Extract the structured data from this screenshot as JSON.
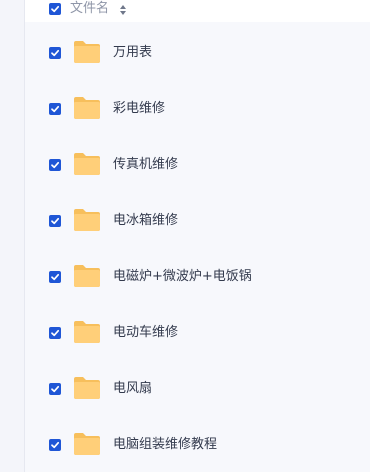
{
  "header": {
    "column_label": "文件名",
    "select_all_checked": true,
    "sort_icon": "sort-icon"
  },
  "files": [
    {
      "name": "万用表",
      "checked": true,
      "icon": "folder-icon"
    },
    {
      "name": "彩电维修",
      "checked": true,
      "icon": "folder-icon"
    },
    {
      "name": "传真机维修",
      "checked": true,
      "icon": "folder-icon"
    },
    {
      "name": "电冰箱维修",
      "checked": true,
      "icon": "folder-icon"
    },
    {
      "name": "电磁炉+微波炉+电饭锅",
      "checked": true,
      "icon": "folder-icon"
    },
    {
      "name": "电动车维修",
      "checked": true,
      "icon": "folder-icon"
    },
    {
      "name": "电风扇",
      "checked": true,
      "icon": "folder-icon"
    },
    {
      "name": "电脑组装维修教程",
      "checked": true,
      "icon": "folder-icon"
    }
  ],
  "colors": {
    "checkbox": "#1f56d6",
    "folder": "#ffcf79",
    "folder_back": "#f7bf5c"
  }
}
